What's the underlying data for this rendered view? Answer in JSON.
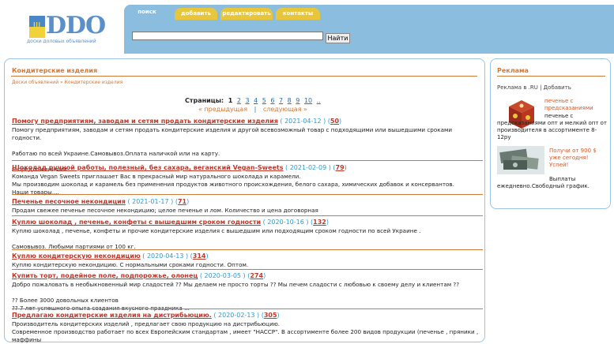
{
  "logo": {
    "brand": "DDO",
    "subtitle": "доски доловых объявлений"
  },
  "tabs": [
    {
      "label": "поиск",
      "active": true
    },
    {
      "label": "добавить",
      "active": false
    },
    {
      "label": "редактировать",
      "active": false
    },
    {
      "label": "контакты",
      "active": false
    }
  ],
  "search": {
    "value": "",
    "button_label": "Найти"
  },
  "main": {
    "title": "Кондитерские изделия",
    "breadcrumb": {
      "root": "Доски объявлений",
      "sep": "»",
      "current": "Кондитерские изделия"
    },
    "pager": {
      "label": "Страницы:",
      "current": "1",
      "pages": [
        "2",
        "3",
        "4",
        "5",
        "6",
        "7",
        "8",
        "9",
        "10"
      ],
      "more": "..",
      "prev": "« предыдущая",
      "sep": "|",
      "next": "следующая »"
    },
    "listings": [
      {
        "title": "Помогу предприятиям, заводам и сетям продать кондитерские изделия",
        "date": "( 2021-04-12 )",
        "count": "50",
        "body": "Помогу предприятиям, заводам и сетям продать кондитерские изделия и другой всевозможный товар с подходящими или вышедшими сроками годности.\n\nРаботаю по всей Украине.Самовывоз.Оплата наличкой или на карту.\n\nС предложениями"
      },
      {
        "title": "Шоколад ручной работы, полезный, без сахара, веганский Vegan-Sweets",
        "date": "( 2021-02-09 )",
        "count": "79",
        "body": "Команда Vegan Sweets приглашает Вас в прекрасный мир натурального шоколада и карамели.\nМы производим шоколад и карамель без применения продуктов животного происхождения, белого сахара, химических добавок и консервантов.\nНаши товары,..."
      },
      {
        "title": "Печенье песочное некондиция",
        "date": "( 2021-01-17 )",
        "count": "71",
        "body": "Продам свежее печенье песочное некондицию; целое печенье и лом. Количество и цена договорная"
      },
      {
        "title": "Куплю шоколад , печенье, конфеты с вышедшим сроком годности",
        "date": "( 2020-10-16 )",
        "count": "132",
        "body": "Куплю шоколад , печенье, конфеты и прочие кондитерские изделия с вышедшим или подходящим сроком годности по всей Украине .\n\nСамовывоз. Любыми партиями от 100 кг."
      },
      {
        "title": "Куплю кондитерскую некондицию",
        "date": "( 2020-04-13 )",
        "count": "314",
        "body": "Куплю кондитерскую некондицию. С нормальными сроками годности. Оптом."
      },
      {
        "title": "Купить торт, подейное поле, подпорожье, олонец",
        "date": "( 2020-03-05 )",
        "count": "274",
        "body": "Добро пожаловать в необыкновенный мир сладостей ?? Мы делаем не просто торты ?? Мы печем сладости с любовью к своему делу и клиентам ??\n\n?? Более 3000 довольных клиентов\n?? 7 лет успешного опыта создания вкусного праздника ..."
      },
      {
        "title": "Предлагаю кондитерские изделия на дистрибьюцию.",
        "date": "( 2020-02-13 )",
        "count": "305",
        "body": "Производитель кондитерских изделий , предлагает свою продукцию на дистрибьюцию.\nСовременное производство работает по всех Европейским стандартам , имеет \"HACCP\". В ассортименте более 200 видов продукции (печенье , пряники , маффины"
      }
    ]
  },
  "ads": {
    "title": "Реклама",
    "source": "Реклама в .RU | Добавить",
    "items": [
      {
        "highlight": "печенье с предсказаниями",
        "text": "печенье с предсказаниями опт и мелкий опт от производителя в ассортименте 8-12ру",
        "image": "cookie-box-image"
      },
      {
        "highlight": "Получи от 900 $ уже сегодня! Успей!",
        "text": "Выплаты ежедневно.Свободный график.",
        "image": "money-image"
      }
    ]
  },
  "colors": {
    "tab_blue": "#8bbddf",
    "tab_yellow": "#e8c63c",
    "accent_orange": "#d07a3a",
    "title_red": "#c0392b",
    "date_blue": "#2b9bd0",
    "link_blue": "#2b6fb5"
  }
}
